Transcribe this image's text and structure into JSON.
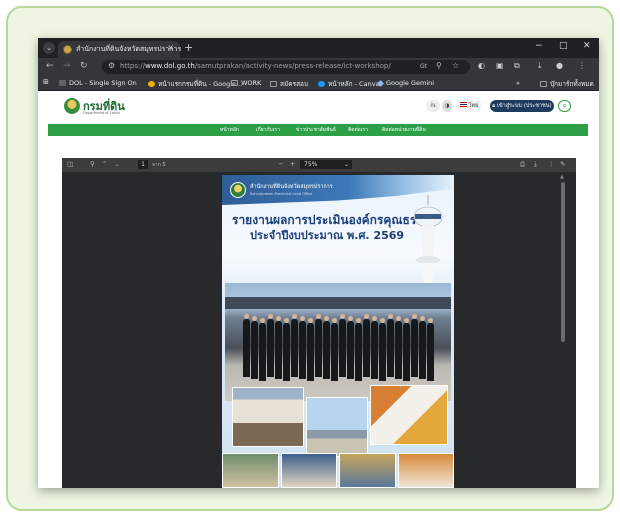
{
  "browser": {
    "tab_title": "สำนักงานที่ดินจังหวัดสมุทรปราการ",
    "new_tab": "+",
    "tab_close": "×",
    "window_min": "−",
    "window_max": "□",
    "window_close": "✕",
    "url_scheme": "https://",
    "url_host": "www.dol.go.th",
    "url_path": "/samutprakan/activity-news/press-release/ict-workshop/",
    "bookmarks": [
      {
        "label": "DOL - Single Sign On",
        "color": "#5f6368"
      },
      {
        "label": "หน้าแรกกรมที่ดิน - Google...",
        "color": "#f4b400"
      },
      {
        "label": "WORK",
        "color": "#9aa0a6"
      },
      {
        "label": "สมัครสอบ",
        "color": "#9aa0a6"
      },
      {
        "label": "หน้าหลัก - Canva",
        "color": "#1a9af6"
      },
      {
        "label": "Google Gemini",
        "color": "#8ab4f8"
      }
    ],
    "bookmarks_more": "»",
    "bookmarks_all": "บุ๊กมาร์กทั้งหมด"
  },
  "site": {
    "logo_text": "กรมที่ดิน",
    "logo_sub": "Department of Lands",
    "lang_label": "ไทย",
    "login_label": "เข้าสู่ระบบ (ประชาชน)",
    "accessibility_label": "กเ",
    "nav": [
      "หน้าหลัก",
      "เกี่ยวกับเรา",
      "ข่าวประชาสัมพันธ์",
      "ติดต่อเรา",
      "ติดต่อหน่วยงานที่ดิน"
    ]
  },
  "pdf_viewer": {
    "page_current": "1",
    "page_total": "จาก 5",
    "zoom": "75%",
    "zoom_minus": "−",
    "zoom_plus": "+"
  },
  "document": {
    "org_name": "สำนักงานที่ดินจังหวัดสมุทรปราการ",
    "org_name_en": "Samutprakan Provincial Land Office",
    "title_line1": "รายงานผลการประเมินองค์กรคุณธรรม",
    "title_line2": "ประจำปีงบประมาณ พ.ศ. 2569"
  },
  "colors": {
    "frame_bg": "#eef6e3",
    "frame_border": "#b7d89a",
    "site_green": "#2d9f46",
    "title_blue": "#1d3f7a",
    "login_button": "#1f3a5f"
  }
}
